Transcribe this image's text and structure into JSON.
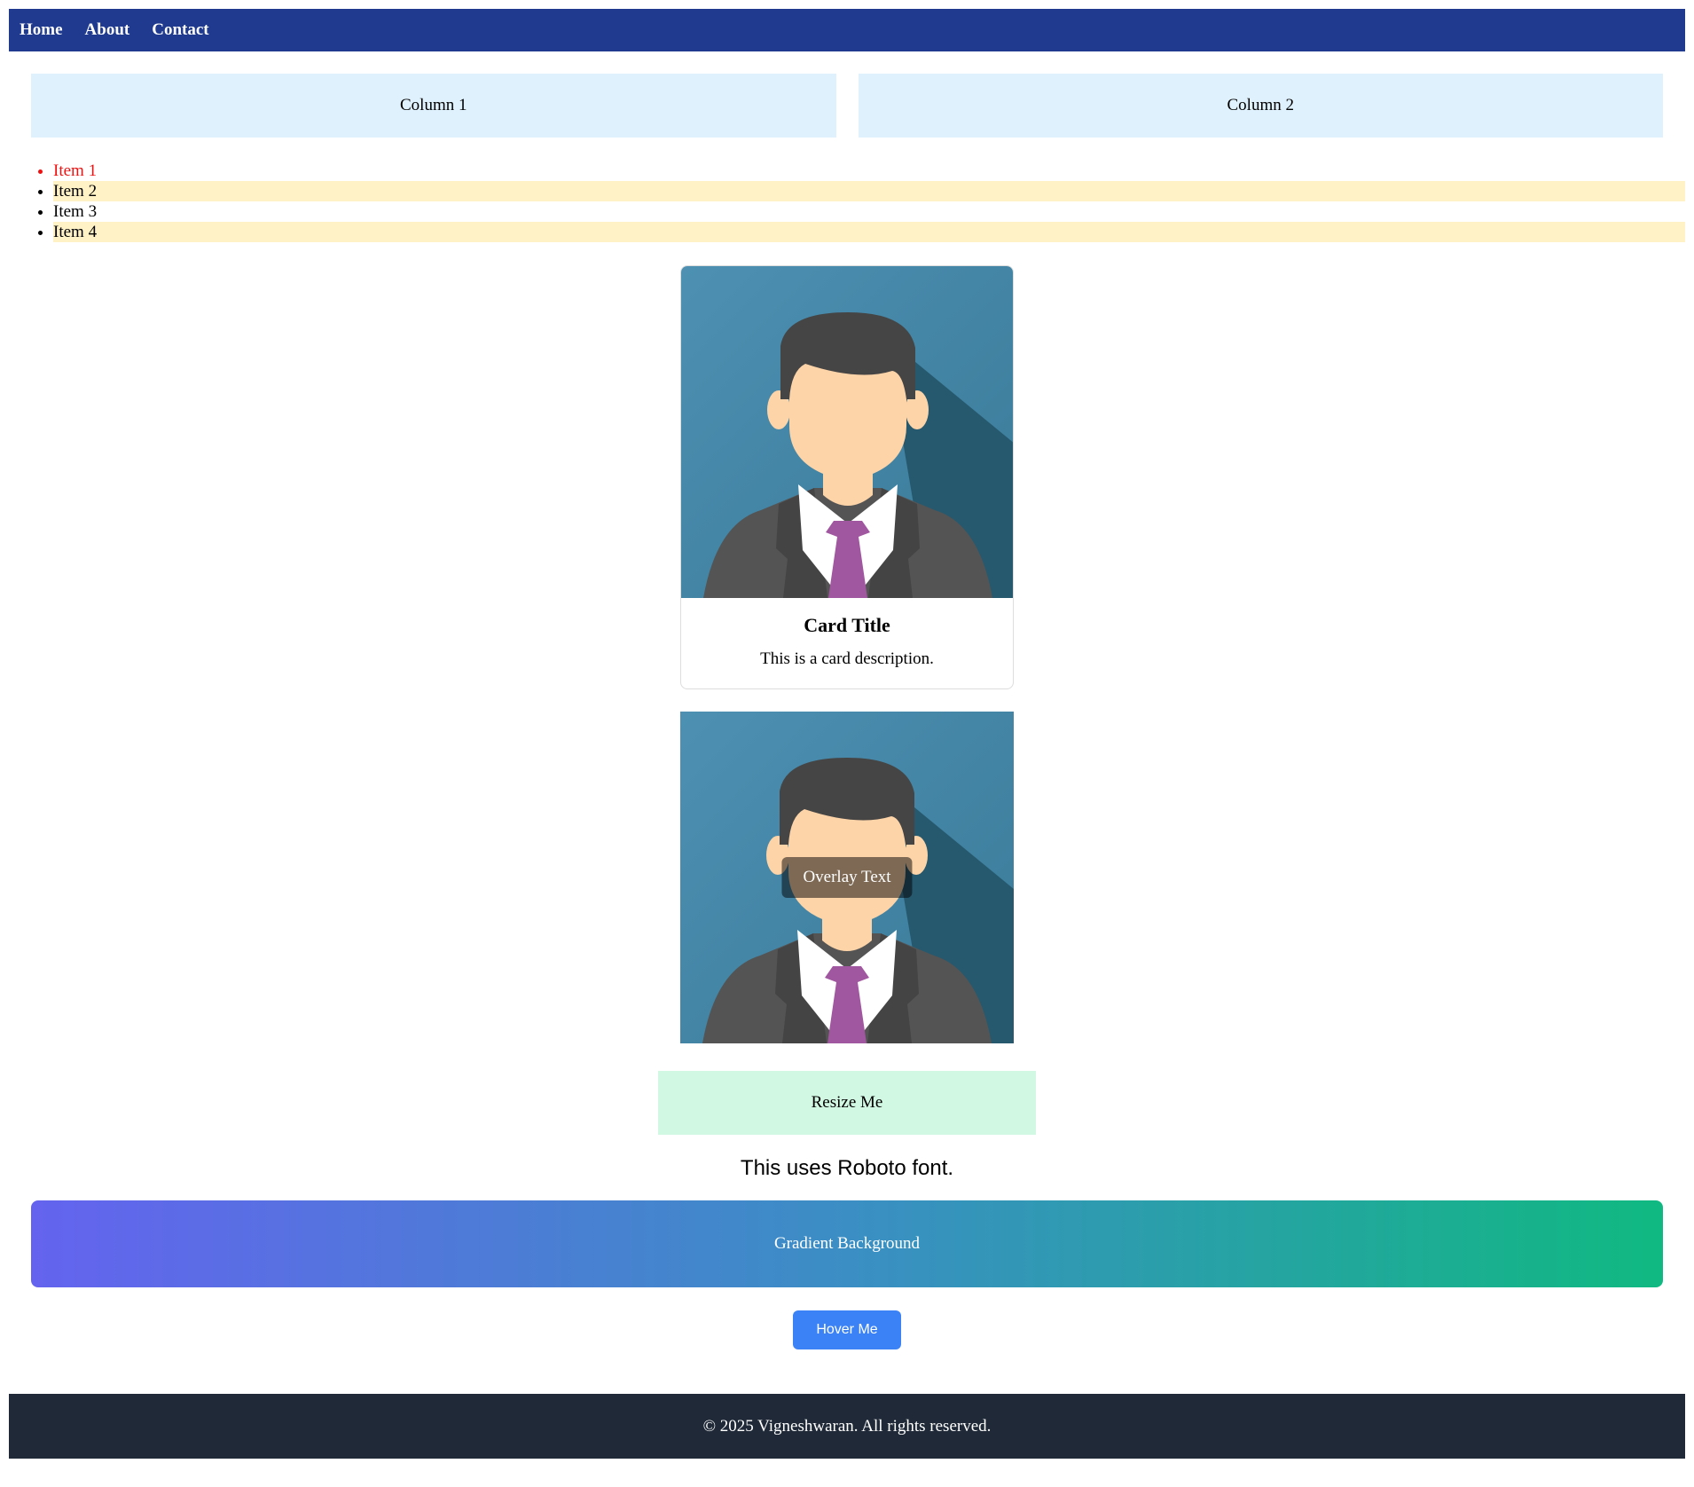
{
  "nav": {
    "links": [
      {
        "label": "Home"
      },
      {
        "label": "About"
      },
      {
        "label": "Contact"
      }
    ]
  },
  "columns": [
    {
      "label": "Column 1"
    },
    {
      "label": "Column 2"
    }
  ],
  "list": {
    "items": [
      {
        "label": "Item 1"
      },
      {
        "label": "Item 2"
      },
      {
        "label": "Item 3"
      },
      {
        "label": "Item 4"
      }
    ]
  },
  "card": {
    "title": "Card Title",
    "description": "This is a card description.",
    "image_icon": "businessman-avatar-icon"
  },
  "overlay": {
    "text": "Overlay Text",
    "image_icon": "businessman-avatar-icon"
  },
  "resize": {
    "label": "Resize Me"
  },
  "font_demo": {
    "text": "This uses Roboto font."
  },
  "gradient": {
    "label": "Gradient Background",
    "color_start": "#6463ef",
    "color_end": "#10b981"
  },
  "button": {
    "label": "Hover Me",
    "color": "#3b82f6"
  },
  "footer": {
    "text": "© 2025 Vigneshwaran. All rights reserved."
  },
  "colors": {
    "nav_bg": "#1f3a8e",
    "column_bg": "#dff1fd",
    "list_active": "#ee1111",
    "list_alt_bg": "#fff2c7",
    "resize_bg": "#d1f8e3",
    "footer_bg": "#1f2937"
  }
}
